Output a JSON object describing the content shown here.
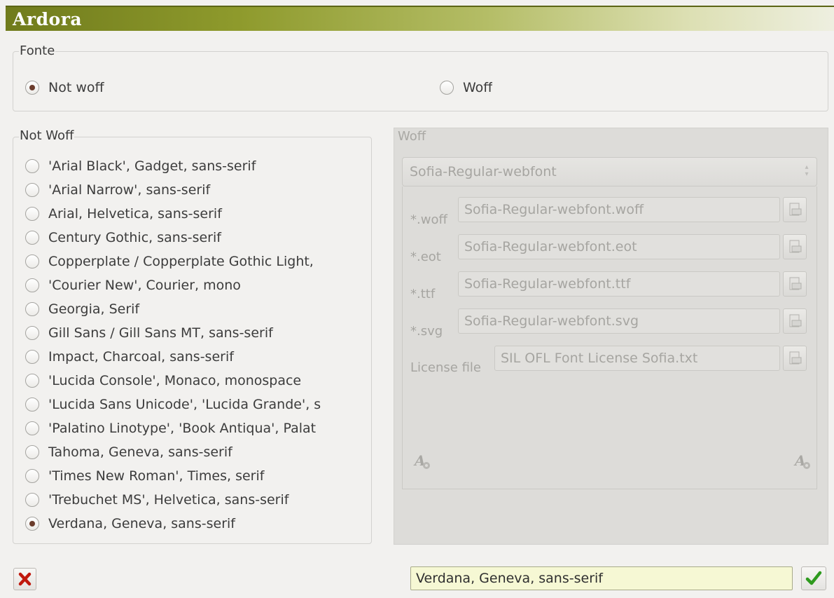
{
  "window": {
    "title": "Ardora"
  },
  "fonte": {
    "label": "Fonte",
    "options": [
      {
        "label": "Not woff",
        "selected": true
      },
      {
        "label": "Woff",
        "selected": false
      }
    ]
  },
  "not_woff": {
    "label": "Not Woff",
    "fonts": [
      {
        "label": "'Arial Black', Gadget, sans-serif",
        "selected": false
      },
      {
        "label": "'Arial Narrow', sans-serif",
        "selected": false
      },
      {
        "label": "Arial, Helvetica, sans-serif",
        "selected": false
      },
      {
        "label": "Century Gothic, sans-serif",
        "selected": false
      },
      {
        "label": "Copperplate / Copperplate Gothic Light,",
        "selected": false
      },
      {
        "label": "'Courier New', Courier, mono",
        "selected": false
      },
      {
        "label": "Georgia, Serif",
        "selected": false
      },
      {
        "label": "Gill Sans / Gill Sans MT, sans-serif",
        "selected": false
      },
      {
        "label": "Impact, Charcoal, sans-serif",
        "selected": false
      },
      {
        "label": "'Lucida Console', Monaco, monospace",
        "selected": false
      },
      {
        "label": "'Lucida Sans Unicode', 'Lucida Grande', s",
        "selected": false
      },
      {
        "label": "'Palatino Linotype', 'Book Antiqua', Palat",
        "selected": false
      },
      {
        "label": "Tahoma, Geneva, sans-serif",
        "selected": false
      },
      {
        "label": "'Times New Roman', Times, serif",
        "selected": false
      },
      {
        "label": "'Trebuchet MS', Helvetica, sans-serif",
        "selected": false
      },
      {
        "label": "Verdana, Geneva, sans-serif",
        "selected": true
      }
    ]
  },
  "woff": {
    "label": "Woff",
    "font_select": "Sofia-Regular-webfont",
    "files": [
      {
        "label": "*.woff",
        "value": "Sofia-Regular-webfont.woff"
      },
      {
        "label": "*.eot",
        "value": "Sofia-Regular-webfont.eot"
      },
      {
        "label": "*.ttf",
        "value": "Sofia-Regular-webfont.ttf"
      },
      {
        "label": "*.svg",
        "value": "Sofia-Regular-webfont.svg"
      },
      {
        "label": "License file",
        "value": "SIL OFL Font License Sofia.txt"
      }
    ]
  },
  "footer": {
    "result_value": "Verdana, Geneva, sans-serif"
  },
  "colors": {
    "title_start": "#707b1c",
    "title_end": "#eeefe0",
    "cancel": "#c0180c",
    "ok": "#2e9a1e",
    "result_bg": "#f6f8d4"
  }
}
